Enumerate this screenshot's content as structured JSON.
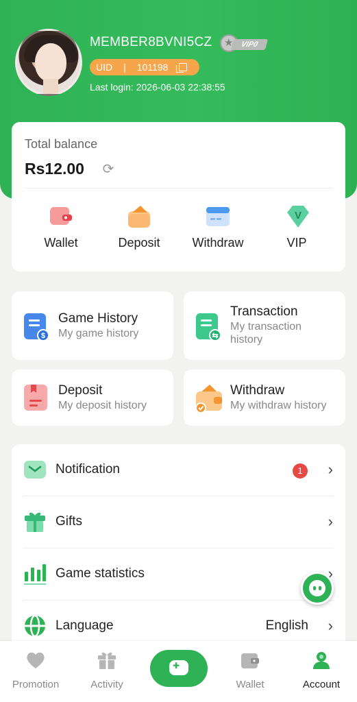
{
  "profile": {
    "username": "MEMBER8BVNI5CZ",
    "vip_tag": "VIP0",
    "uid_label": "UID",
    "uid_separator": "|",
    "uid_value": "101198",
    "last_login": "Last login: 2026-06-03 22:38:55"
  },
  "balance": {
    "label": "Total balance",
    "value": "Rs12.00"
  },
  "quick_actions": [
    {
      "label": "Wallet",
      "icon": "wallet-icon"
    },
    {
      "label": "Deposit",
      "icon": "deposit-icon"
    },
    {
      "label": "Withdraw",
      "icon": "withdraw-icon"
    },
    {
      "label": "VIP",
      "icon": "vip-icon"
    }
  ],
  "history_cards": [
    {
      "title": "Game History",
      "subtitle": "My game history",
      "icon": "game-history-icon"
    },
    {
      "title": "Transaction",
      "subtitle": "My transaction history",
      "icon": "transaction-icon"
    },
    {
      "title": "Deposit",
      "subtitle": "My deposit history",
      "icon": "deposit-history-icon"
    },
    {
      "title": "Withdraw",
      "subtitle": "My withdraw history",
      "icon": "withdraw-history-icon"
    }
  ],
  "menu": [
    {
      "label": "Notification",
      "badge": "1",
      "icon": "mail-icon"
    },
    {
      "label": "Gifts",
      "icon": "gift-icon"
    },
    {
      "label": "Game statistics",
      "icon": "bar-chart-icon"
    },
    {
      "label": "Language",
      "value": "English",
      "icon": "globe-icon"
    }
  ],
  "tabbar": [
    {
      "label": "Promotion",
      "icon": "heart-icon"
    },
    {
      "label": "Activity",
      "icon": "gift-box-icon"
    },
    {
      "label": "",
      "icon": "gamepad-icon"
    },
    {
      "label": "Wallet",
      "icon": "wallet-icon"
    },
    {
      "label": "Account",
      "icon": "account-icon",
      "active": true
    }
  ],
  "colors": {
    "primary_green": "#2fb256",
    "uid_orange": "#f6a54a",
    "badge_red": "#e74a45"
  }
}
